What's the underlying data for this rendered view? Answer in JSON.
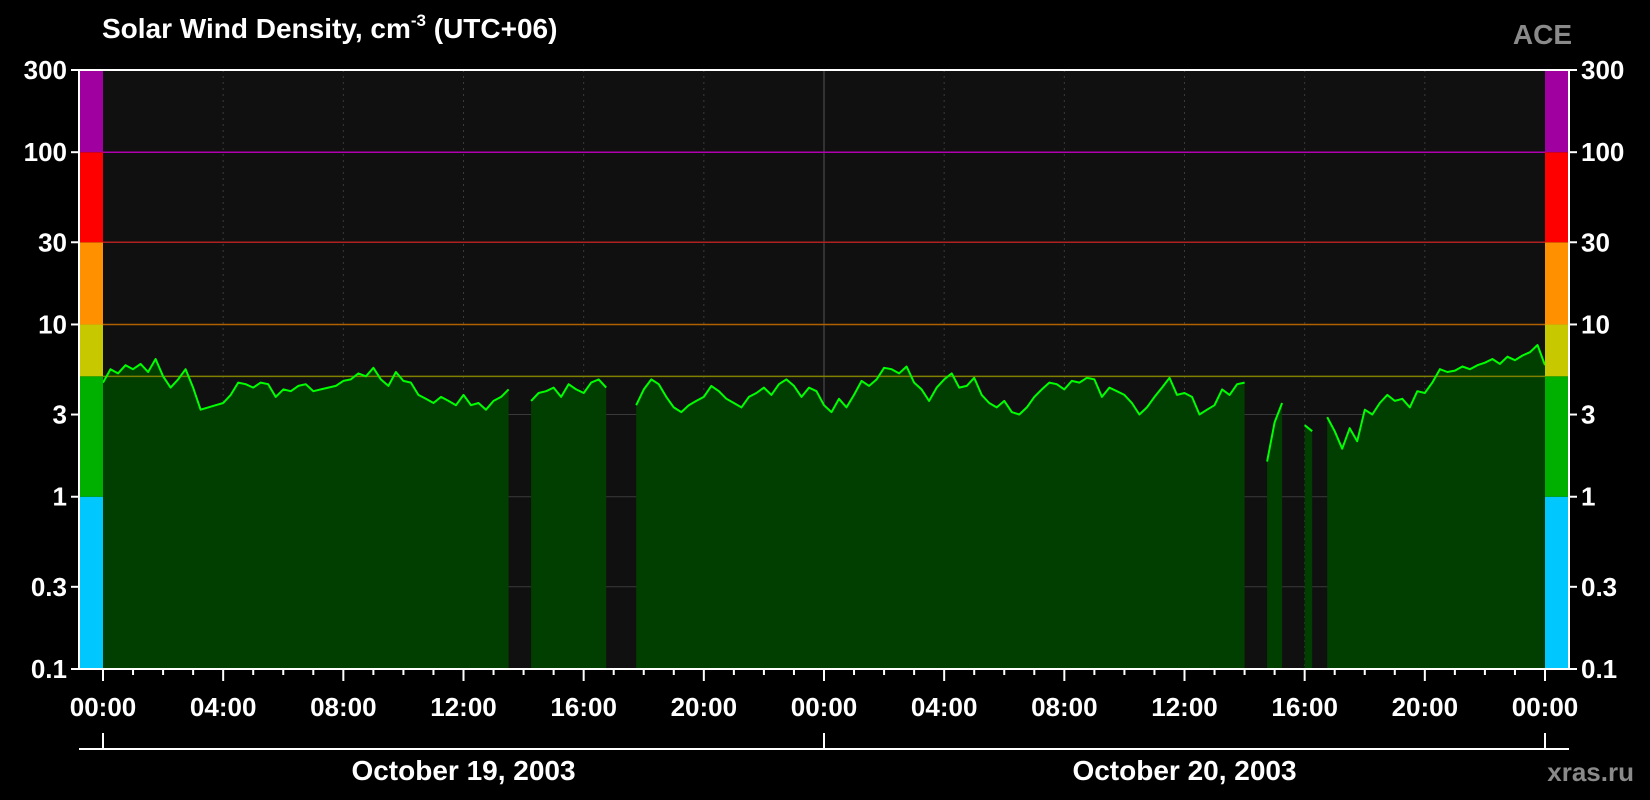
{
  "chart_data": {
    "type": "area",
    "title": "Solar Wind Density, cm",
    "title_superscript": "-3",
    "title_suffix": "(UTC+06)",
    "source": "ACE",
    "watermark": "xras.ru",
    "y_scale": "log",
    "ylim": [
      0.1,
      300
    ],
    "y_ticks": [
      {
        "value": 300,
        "label": "300"
      },
      {
        "value": 100,
        "label": "100"
      },
      {
        "value": 30,
        "label": "30"
      },
      {
        "value": 10,
        "label": "10"
      },
      {
        "value": 3,
        "label": "3"
      },
      {
        "value": 1,
        "label": "1"
      },
      {
        "value": 0.3,
        "label": "0.3"
      },
      {
        "value": 0.1,
        "label": "0.1"
      }
    ],
    "xlim_hours": [
      0,
      48
    ],
    "x_ticks": [
      {
        "hour": 0,
        "label": "00:00"
      },
      {
        "hour": 4,
        "label": "04:00"
      },
      {
        "hour": 8,
        "label": "08:00"
      },
      {
        "hour": 12,
        "label": "12:00"
      },
      {
        "hour": 16,
        "label": "16:00"
      },
      {
        "hour": 20,
        "label": "20:00"
      },
      {
        "hour": 24,
        "label": "00:00"
      },
      {
        "hour": 28,
        "label": "04:00"
      },
      {
        "hour": 32,
        "label": "08:00"
      },
      {
        "hour": 36,
        "label": "12:00"
      },
      {
        "hour": 40,
        "label": "16:00"
      },
      {
        "hour": 44,
        "label": "20:00"
      },
      {
        "hour": 48,
        "label": "00:00"
      }
    ],
    "dates": [
      {
        "label": "October 19, 2003",
        "start_hour": 0,
        "end_hour": 24
      },
      {
        "label": "October 20, 2003",
        "start_hour": 24,
        "end_hour": 48
      }
    ],
    "level_bands": [
      {
        "from": 0.1,
        "to": 1,
        "color": "#00c8ff"
      },
      {
        "from": 1,
        "to": 5,
        "color": "#00b000"
      },
      {
        "from": 5,
        "to": 10,
        "color": "#c8c800"
      },
      {
        "from": 10,
        "to": 30,
        "color": "#ff9000"
      },
      {
        "from": 30,
        "to": 100,
        "color": "#ff0000"
      },
      {
        "from": 100,
        "to": 300,
        "color": "#a000a0"
      }
    ],
    "threshold_lines": [
      {
        "value": 5,
        "color": "#808000"
      },
      {
        "value": 10,
        "color": "#b06000"
      },
      {
        "value": 30,
        "color": "#b02020"
      },
      {
        "value": 100,
        "color": "#b000b0"
      }
    ],
    "series": [
      {
        "color": "#00ff00",
        "fill_color": "#003f00",
        "points": [
          [
            0.0,
            4.6
          ],
          [
            0.25,
            5.5
          ],
          [
            0.5,
            5.2
          ],
          [
            0.75,
            5.8
          ],
          [
            1.0,
            5.5
          ],
          [
            1.25,
            5.9
          ],
          [
            1.5,
            5.3
          ],
          [
            1.75,
            6.3
          ],
          [
            2.0,
            5.0
          ],
          [
            2.25,
            4.3
          ],
          [
            2.5,
            4.8
          ],
          [
            2.75,
            5.5
          ],
          [
            3.0,
            4.3
          ],
          [
            3.25,
            3.2
          ],
          [
            3.5,
            3.3
          ],
          [
            3.75,
            3.4
          ],
          [
            4.0,
            3.5
          ],
          [
            4.25,
            3.9
          ],
          [
            4.5,
            4.6
          ],
          [
            4.75,
            4.5
          ],
          [
            5.0,
            4.3
          ],
          [
            5.25,
            4.6
          ],
          [
            5.5,
            4.5
          ],
          [
            5.75,
            3.8
          ],
          [
            6.0,
            4.2
          ],
          [
            6.25,
            4.1
          ],
          [
            6.5,
            4.4
          ],
          [
            6.75,
            4.5
          ],
          [
            7.0,
            4.1
          ],
          [
            7.25,
            4.2
          ],
          [
            7.5,
            4.3
          ],
          [
            7.75,
            4.4
          ],
          [
            8.0,
            4.7
          ],
          [
            8.25,
            4.8
          ],
          [
            8.5,
            5.2
          ],
          [
            8.75,
            5.0
          ],
          [
            9.0,
            5.6
          ],
          [
            9.25,
            4.8
          ],
          [
            9.5,
            4.4
          ],
          [
            9.75,
            5.3
          ],
          [
            10.0,
            4.7
          ],
          [
            10.25,
            4.6
          ],
          [
            10.5,
            3.9
          ],
          [
            10.75,
            3.7
          ],
          [
            11.0,
            3.5
          ],
          [
            11.25,
            3.8
          ],
          [
            11.5,
            3.6
          ],
          [
            11.75,
            3.4
          ],
          [
            12.0,
            3.9
          ],
          [
            12.25,
            3.4
          ],
          [
            12.5,
            3.5
          ],
          [
            12.75,
            3.2
          ],
          [
            13.0,
            3.6
          ],
          [
            13.25,
            3.8
          ],
          [
            13.5,
            4.2
          ],
          [
            14.25,
            3.6
          ],
          [
            14.5,
            4.0
          ],
          [
            14.75,
            4.1
          ],
          [
            15.0,
            4.3
          ],
          [
            15.25,
            3.8
          ],
          [
            15.5,
            4.5
          ],
          [
            15.75,
            4.2
          ],
          [
            16.0,
            4.0
          ],
          [
            16.25,
            4.6
          ],
          [
            16.5,
            4.8
          ],
          [
            16.75,
            4.3
          ],
          [
            17.75,
            3.4
          ],
          [
            18.0,
            4.2
          ],
          [
            18.25,
            4.8
          ],
          [
            18.5,
            4.5
          ],
          [
            18.75,
            3.8
          ],
          [
            19.0,
            3.3
          ],
          [
            19.25,
            3.1
          ],
          [
            19.5,
            3.4
          ],
          [
            19.75,
            3.6
          ],
          [
            20.0,
            3.8
          ],
          [
            20.25,
            4.4
          ],
          [
            20.5,
            4.1
          ],
          [
            20.75,
            3.7
          ],
          [
            21.0,
            3.5
          ],
          [
            21.25,
            3.3
          ],
          [
            21.5,
            3.8
          ],
          [
            21.75,
            4.0
          ],
          [
            22.0,
            4.3
          ],
          [
            22.25,
            3.9
          ],
          [
            22.5,
            4.5
          ],
          [
            22.75,
            4.8
          ],
          [
            23.0,
            4.4
          ],
          [
            23.25,
            3.8
          ],
          [
            23.5,
            4.3
          ],
          [
            23.75,
            4.1
          ],
          [
            24.0,
            3.4
          ],
          [
            24.25,
            3.1
          ],
          [
            24.5,
            3.7
          ],
          [
            24.75,
            3.3
          ],
          [
            25.0,
            3.9
          ],
          [
            25.25,
            4.7
          ],
          [
            25.5,
            4.4
          ],
          [
            25.75,
            4.8
          ],
          [
            26.0,
            5.6
          ],
          [
            26.25,
            5.5
          ],
          [
            26.5,
            5.2
          ],
          [
            26.75,
            5.7
          ],
          [
            27.0,
            4.6
          ],
          [
            27.25,
            4.2
          ],
          [
            27.5,
            3.6
          ],
          [
            27.75,
            4.3
          ],
          [
            28.0,
            4.8
          ],
          [
            28.25,
            5.2
          ],
          [
            28.5,
            4.3
          ],
          [
            28.75,
            4.4
          ],
          [
            29.0,
            4.9
          ],
          [
            29.25,
            3.9
          ],
          [
            29.5,
            3.5
          ],
          [
            29.75,
            3.3
          ],
          [
            30.0,
            3.6
          ],
          [
            30.25,
            3.1
          ],
          [
            30.5,
            3.0
          ],
          [
            30.75,
            3.3
          ],
          [
            31.0,
            3.8
          ],
          [
            31.25,
            4.2
          ],
          [
            31.5,
            4.6
          ],
          [
            31.75,
            4.5
          ],
          [
            32.0,
            4.2
          ],
          [
            32.25,
            4.7
          ],
          [
            32.5,
            4.6
          ],
          [
            32.75,
            4.9
          ],
          [
            33.0,
            4.8
          ],
          [
            33.25,
            3.8
          ],
          [
            33.5,
            4.3
          ],
          [
            33.75,
            4.1
          ],
          [
            34.0,
            3.9
          ],
          [
            34.25,
            3.5
          ],
          [
            34.5,
            3.0
          ],
          [
            34.75,
            3.3
          ],
          [
            35.0,
            3.8
          ],
          [
            35.25,
            4.3
          ],
          [
            35.5,
            4.9
          ],
          [
            35.75,
            3.9
          ],
          [
            36.0,
            4.0
          ],
          [
            36.25,
            3.8
          ],
          [
            36.5,
            3.0
          ],
          [
            36.75,
            3.2
          ],
          [
            37.0,
            3.4
          ],
          [
            37.25,
            4.2
          ],
          [
            37.5,
            3.9
          ],
          [
            37.75,
            4.5
          ],
          [
            38.0,
            4.6
          ],
          [
            38.75,
            1.6
          ],
          [
            39.0,
            2.7
          ],
          [
            39.25,
            3.5
          ],
          [
            40.0,
            2.6
          ],
          [
            40.25,
            2.4
          ],
          [
            40.75,
            2.9
          ],
          [
            41.0,
            2.4
          ],
          [
            41.25,
            1.9
          ],
          [
            41.5,
            2.5
          ],
          [
            41.75,
            2.1
          ],
          [
            42.0,
            3.2
          ],
          [
            42.25,
            3.0
          ],
          [
            42.5,
            3.5
          ],
          [
            42.75,
            3.9
          ],
          [
            43.0,
            3.6
          ],
          [
            43.25,
            3.7
          ],
          [
            43.5,
            3.3
          ],
          [
            43.75,
            4.1
          ],
          [
            44.0,
            4.0
          ],
          [
            44.25,
            4.6
          ],
          [
            44.5,
            5.5
          ],
          [
            44.75,
            5.3
          ],
          [
            45.0,
            5.4
          ],
          [
            45.25,
            5.7
          ],
          [
            45.5,
            5.5
          ],
          [
            45.75,
            5.8
          ],
          [
            46.0,
            6.0
          ],
          [
            46.25,
            6.3
          ],
          [
            46.5,
            5.9
          ],
          [
            46.75,
            6.5
          ],
          [
            47.0,
            6.2
          ],
          [
            47.25,
            6.6
          ],
          [
            47.5,
            6.9
          ],
          [
            47.75,
            7.6
          ],
          [
            48.0,
            5.8
          ]
        ]
      }
    ]
  }
}
